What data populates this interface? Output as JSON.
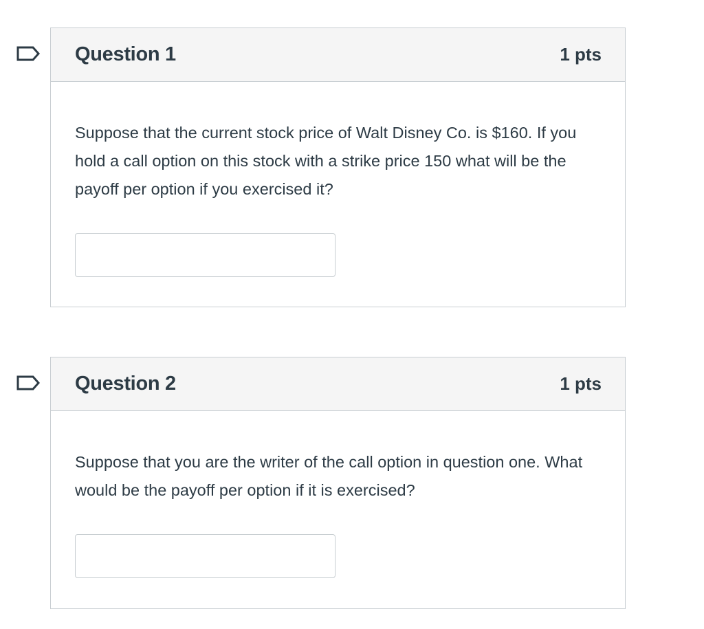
{
  "questions": [
    {
      "title": "Question 1",
      "points": "1 pts",
      "text": "Suppose that the current stock price of Walt Disney Co. is $160. If you hold a call option on this stock with a strike price 150 what will be the payoff per option if you exercised it?",
      "answer_value": "",
      "flag_icon": "bookmark-flag-icon"
    },
    {
      "title": "Question 2",
      "points": "1 pts",
      "text": "Suppose that you are the writer of the call option in question one. What would be the payoff per option if it is exercised?",
      "answer_value": "",
      "flag_icon": "bookmark-flag-icon"
    }
  ],
  "colors": {
    "header_bg": "#f5f5f5",
    "border": "#c7cdd1",
    "text": "#2d3b45",
    "flag_stroke": "#2d3b45"
  }
}
